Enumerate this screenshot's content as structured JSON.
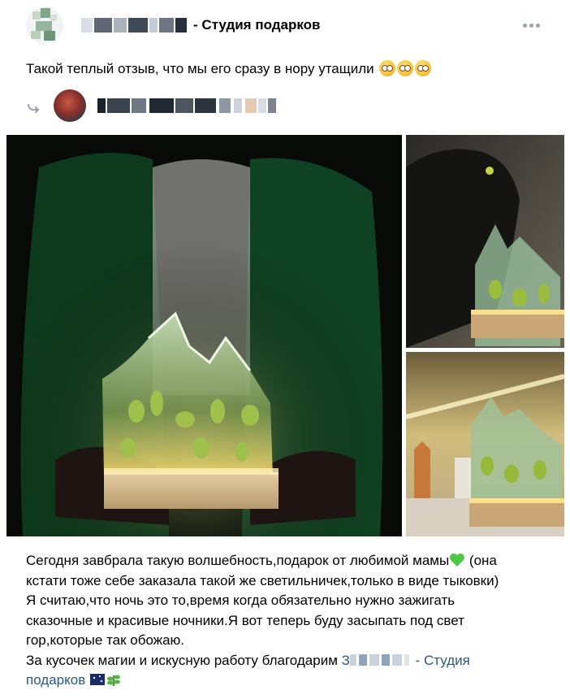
{
  "header": {
    "author_name": "- Студия подарков",
    "avatar_icon": "blurred-avatar-icon",
    "more_icon": "more-horizontal-icon"
  },
  "post": {
    "text": "Такой теплый отзыв, что мы его сразу в нору утащили",
    "emoji_icon": "flushed-face-emoji",
    "emoji_count": 3
  },
  "repost": {
    "icon": "repost-arrow-icon",
    "avatar_icon": "user-avatar-icon"
  },
  "gallery": {
    "photos": [
      {
        "icon": "photo-mountain-lamp-in-hands"
      },
      {
        "icon": "photo-cat-with-lamp"
      },
      {
        "icon": "photo-lamp-on-shelf"
      }
    ]
  },
  "body": {
    "line1_a": "Сегодня завбрала такую волшебность,подарок от любимой мамы",
    "line1_b": " (она",
    "line2": "кстати тоже себе заказала такой же светильничек,только в виде тыковки)",
    "line3": "Я считаю,что ночь это то,время когда обязательно нужно зажигать",
    "line4": "сказочные и красивые ночники.Я вот теперь буду засыпать под свет",
    "line5": "гор,которые так обожаю.",
    "line6_a": "За кусочек магии и искусную работу благодарим ",
    "line6_link_start": "З",
    "line6_link_end": "- Студия",
    "line7_link": "подарков",
    "heart_icon": "green-heart-emoji",
    "extra_icons": [
      "night-sky-emoji",
      "herb-emoji"
    ]
  },
  "colors": {
    "link": "#2a5885",
    "muted_icon": "#99a2ad"
  }
}
